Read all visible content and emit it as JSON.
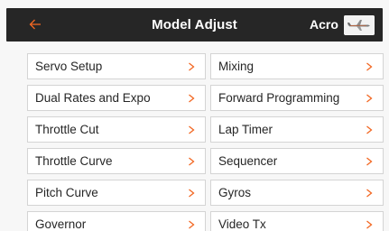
{
  "header": {
    "title": "Model Adjust",
    "model_type": "Acro",
    "back_icon": "back-arrow-icon",
    "thumbnail_icon": "airplane-thumbnail-icon"
  },
  "menu": {
    "rows": [
      {
        "left": "Servo Setup",
        "right": "Mixing"
      },
      {
        "left": "Dual Rates and Expo",
        "right": "Forward Programming"
      },
      {
        "left": "Throttle Cut",
        "right": "Lap Timer"
      },
      {
        "left": "Throttle Curve",
        "right": "Sequencer"
      },
      {
        "left": "Pitch Curve",
        "right": "Gyros"
      },
      {
        "left": "Governor",
        "right": "Video Tx"
      }
    ]
  },
  "colors": {
    "accent": "#f26722",
    "header_bg": "#262626",
    "cell_border": "#d4d4d4",
    "background": "#f7f7f7"
  }
}
